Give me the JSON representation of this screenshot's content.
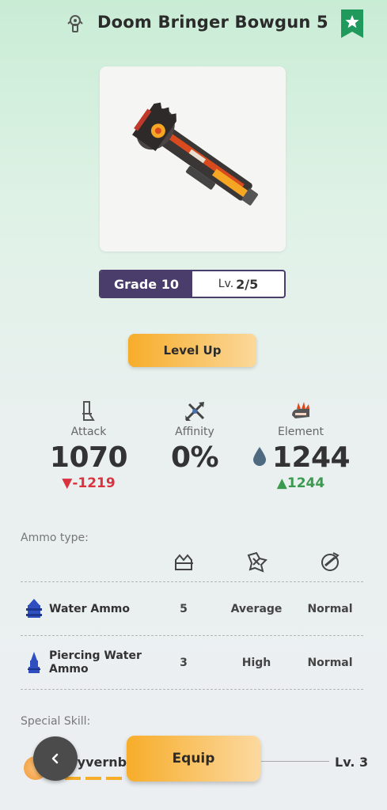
{
  "header": {
    "title": "Doom Bringer Bowgun 5",
    "weapon_type_icon": "bowgun-type-icon",
    "favorite_icon": "star-bookmark-icon"
  },
  "weapon": {
    "image_icon": "bowgun-weapon-image"
  },
  "grade": {
    "grade_label": "Grade 10",
    "level_prefix": "Lv.",
    "level_value": "2/5"
  },
  "actions": {
    "level_up_label": "Level Up",
    "equip_label": "Equip",
    "back_icon": "chevron-left-icon"
  },
  "stats": {
    "attack": {
      "label": "Attack",
      "value": "1070",
      "delta": "-1219",
      "icon": "sword-icon"
    },
    "affinity": {
      "label": "Affinity",
      "value": "0%",
      "icon": "crossed-blades-icon"
    },
    "element": {
      "label": "Element",
      "value": "1244",
      "delta": "1244",
      "icon": "element-claw-icon",
      "element_icon": "water-drop-icon"
    }
  },
  "ammo": {
    "section_label": "Ammo type:",
    "column_icons": [
      "capacity-icon",
      "recoil-icon",
      "reload-icon"
    ],
    "rows": [
      {
        "name": "Water Ammo",
        "capacity": "5",
        "recoil": "Average",
        "reload": "Normal",
        "icon": "water-ammo-icon"
      },
      {
        "name": "Piercing Water Ammo",
        "name_line1": "Piercing Water",
        "name_line2": "Ammo",
        "capacity": "3",
        "recoil": "High",
        "reload": "Normal",
        "icon": "piercing-ammo-icon"
      }
    ]
  },
  "special_skill": {
    "section_label": "Special Skill:",
    "name": "Wyvernbl",
    "level": "Lv. 3",
    "icon": "skill-orb-icon"
  },
  "colors": {
    "accent_orange": "#f7ad2a",
    "grade_purple": "#4a3d6b",
    "negative_red": "#d9333f",
    "positive_green": "#3b9a4f"
  }
}
